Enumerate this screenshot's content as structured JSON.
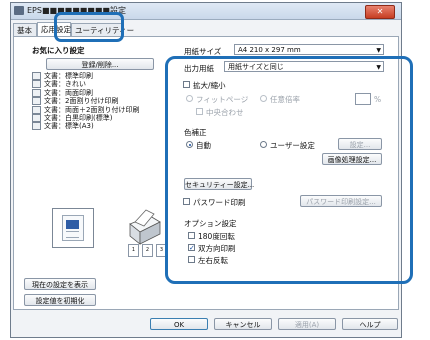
{
  "window": {
    "title": "EPS■■■■■■■■■設定",
    "close_label": "✕"
  },
  "tabs": [
    {
      "label": "基本"
    },
    {
      "label": "応用設定"
    },
    {
      "label": "ユーティリティー"
    }
  ],
  "favorites": {
    "label": "お気に入り設定",
    "register_button": "登録/削除...",
    "items": [
      "文書：標準印刷",
      "文書：きれい",
      "文書：両面印刷",
      "文書：2面割り付け印刷",
      "文書：両面＋2面割り付け印刷",
      "文書：白黒印刷(標準)",
      "文書：標準(A3)"
    ]
  },
  "paper_size": {
    "label": "用紙サイズ",
    "value": "A4 210 x 297 mm"
  },
  "output_paper": {
    "label": "出力用紙",
    "value": "用紙サイズと同じ"
  },
  "scaling": {
    "checkbox_label": "拡大/縮小",
    "fit_page": "フィットページ",
    "any_ratio": "任意倍率",
    "center": "中央合わせ",
    "unit": "%"
  },
  "color_correction": {
    "label": "色補正",
    "auto": "自動",
    "user": "ユーザー設定",
    "settings_button": "設定...",
    "image_button": "画像処理設定..."
  },
  "security_button": "セキュリティー設定...",
  "password": {
    "checkbox_label": "パスワード印刷",
    "button": "パスワード印刷設定..."
  },
  "options": {
    "label": "オプション設定",
    "rotate": "180度回転",
    "duplex": "双方向印刷",
    "mirror": "左右反転",
    "duplex_checked": "✓"
  },
  "preview_pages": [
    "1",
    "2",
    "3"
  ],
  "left_buttons": {
    "show_settings": "現在の設定を表示",
    "reset": "設定値を初期化"
  },
  "footer": {
    "ok": "OK",
    "cancel": "キャンセル",
    "apply": "適用(A)",
    "help": "ヘルプ"
  }
}
